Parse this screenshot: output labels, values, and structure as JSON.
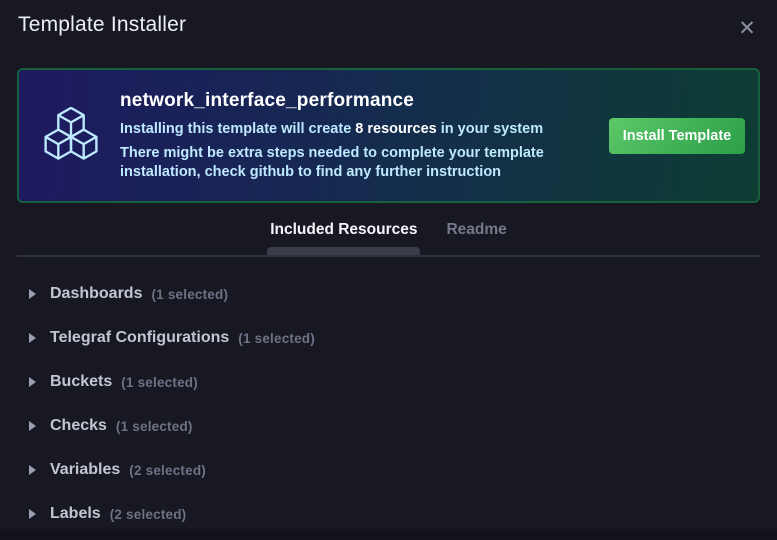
{
  "header": {
    "title": "Template Installer",
    "close_icon": "✕"
  },
  "banner": {
    "template_name": "network_interface_performance",
    "description": {
      "prefix": "Installing this template will create ",
      "highlight": "8 resources",
      "suffix": " in your system"
    },
    "note": "There might be extra steps needed to complete your template installation, check github to find any further instruction",
    "install_button_label": "Install Template",
    "icon": "cubes-icon",
    "colors": {
      "border_green": "#17603c",
      "gradient_left_indigo": "#1e1960",
      "gradient_mid_navy": "#152a50",
      "gradient_right_teal": "#0d3d33",
      "button_green_light": "#5cc868",
      "button_green_dark": "#2b9e48",
      "text_blue": "#bee9ff"
    }
  },
  "tabs": [
    {
      "label": "Included Resources",
      "active": true
    },
    {
      "label": "Readme",
      "active": false
    }
  ],
  "resources": [
    {
      "label": "Dashboards",
      "count": "(1 selected)"
    },
    {
      "label": "Telegraf Configurations",
      "count": "(1 selected)"
    },
    {
      "label": "Buckets",
      "count": "(1 selected)"
    },
    {
      "label": "Checks",
      "count": "(1 selected)"
    },
    {
      "label": "Variables",
      "count": "(2 selected)"
    },
    {
      "label": "Labels",
      "count": "(2 selected)"
    }
  ]
}
